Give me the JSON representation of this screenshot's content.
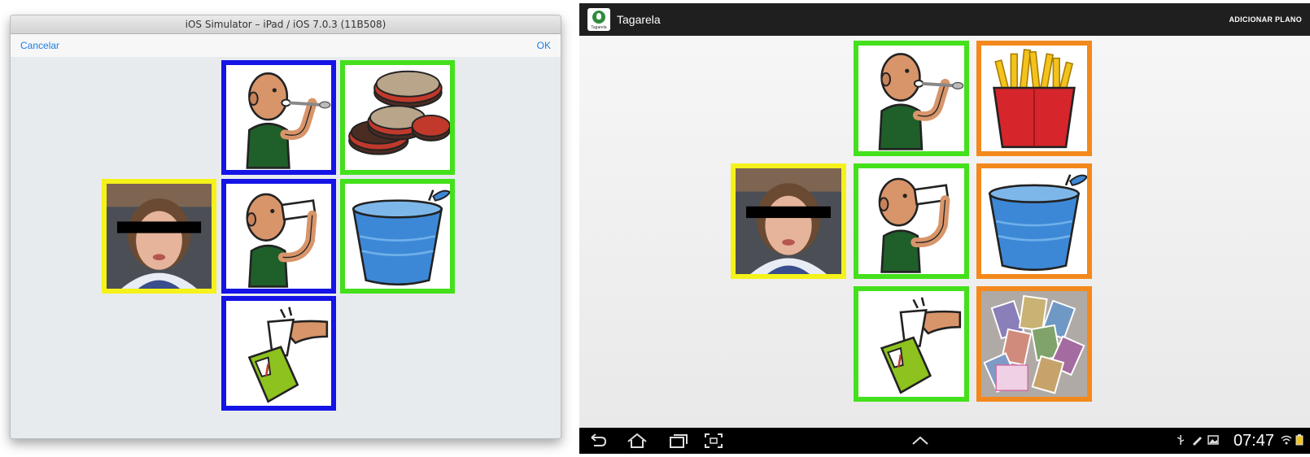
{
  "ios": {
    "window_title": "iOS Simulator – iPad / iOS 7.0.3 (11B508)",
    "cancel_label": "Cancelar",
    "ok_label": "OK"
  },
  "android": {
    "app_name": "Tagarela",
    "logo_text": "Tagarela",
    "action_label": "ADICIONAR PLANO",
    "clock": "07:47"
  },
  "colors": {
    "blue_border": "#1414e6",
    "green_border": "#44e01b",
    "yellow_border": "#f4f21a",
    "orange_border": "#f3891c",
    "ios_link": "#1a7ee6",
    "android_bar": "#1f1f1f"
  },
  "cards": {
    "ios": [
      {
        "symbol": "child-photo",
        "border": "yellow"
      },
      {
        "symbol": "eat-pictogram",
        "border": "blue"
      },
      {
        "symbol": "drink-pictogram",
        "border": "blue"
      },
      {
        "symbol": "pour-juice-pictogram",
        "border": "blue"
      },
      {
        "symbol": "cookies-pictogram",
        "border": "green"
      },
      {
        "symbol": "water-cup-pictogram",
        "border": "green"
      }
    ],
    "android": [
      {
        "symbol": "child-photo",
        "border": "yellow"
      },
      {
        "symbol": "eat-pictogram",
        "border": "green"
      },
      {
        "symbol": "drink-pictogram",
        "border": "green"
      },
      {
        "symbol": "pour-juice-pictogram",
        "border": "green"
      },
      {
        "symbol": "french-fries-pictogram",
        "border": "orange"
      },
      {
        "symbol": "water-cup-pictogram",
        "border": "orange"
      },
      {
        "symbol": "trading-cards-photo",
        "border": "orange"
      }
    ]
  },
  "icons": [
    "back-icon",
    "home-icon",
    "recent-apps-icon",
    "screenshot-icon",
    "chevron-up-icon",
    "usb-icon",
    "pen-icon",
    "image-icon",
    "wifi-icon",
    "battery-icon"
  ]
}
